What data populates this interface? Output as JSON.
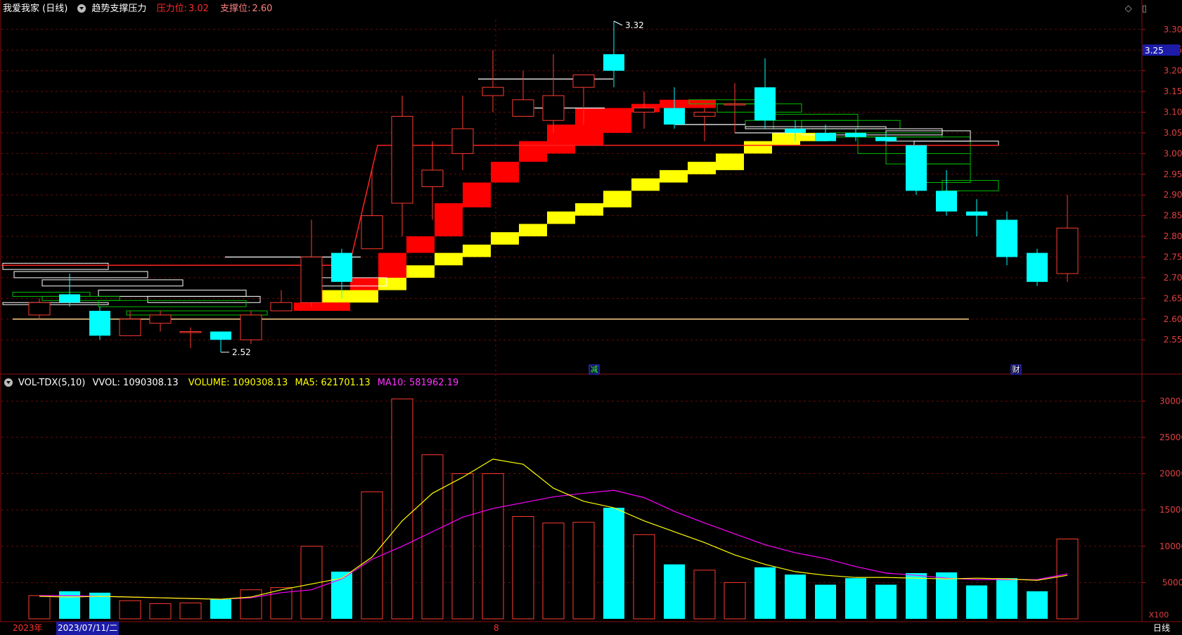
{
  "header": {
    "title": "我爱我家 (日线)",
    "indicator": "趋势支撑压力",
    "pressure_label": "压力位:",
    "pressure_value": "3.02",
    "support_label": "支撑位:",
    "support_value": "2.60"
  },
  "vol_header": {
    "name": "VOL-TDX(5,10)",
    "vvol": "VVOL: 1090308.13",
    "volume": "VOLUME: 1090308.13",
    "ma5": "MA5: 621701.13",
    "ma10": "MA10: 581962.19"
  },
  "colors": {
    "up": "#ff3b30",
    "down": "#00ffff",
    "ma5": "#ffff00",
    "ma10": "#ff00ff",
    "red_band": "#ff0000",
    "yellow_band": "#ffff00",
    "support": "#ffd28a",
    "pressure": "#ff2020"
  },
  "chart_data": [
    {
      "type": "candlestick",
      "ylim": [
        2.51,
        3.34
      ],
      "yticks": [
        2.55,
        2.6,
        2.65,
        2.7,
        2.75,
        2.8,
        2.85,
        2.9,
        2.95,
        3.0,
        3.05,
        3.1,
        3.15,
        3.2,
        3.25,
        3.3
      ],
      "current_price": "3.25",
      "high_annotation": "3.32",
      "low_annotation": "2.52",
      "support_level": 2.6,
      "pressure_level": 3.02,
      "event_markers": [
        "减",
        "财"
      ],
      "candles": [
        {
          "o": 2.61,
          "c": 2.64,
          "h": 2.65,
          "l": 2.6
        },
        {
          "o": 2.66,
          "c": 2.64,
          "h": 2.71,
          "l": 2.63
        },
        {
          "o": 2.62,
          "c": 2.56,
          "h": 2.63,
          "l": 2.55
        },
        {
          "o": 2.56,
          "c": 2.6,
          "h": 2.62,
          "l": 2.56
        },
        {
          "o": 2.59,
          "c": 2.61,
          "h": 2.62,
          "l": 2.57
        },
        {
          "o": 2.57,
          "c": 2.57,
          "h": 2.58,
          "l": 2.53
        },
        {
          "o": 2.57,
          "c": 2.55,
          "h": 2.57,
          "l": 2.52
        },
        {
          "o": 2.55,
          "c": 2.61,
          "h": 2.62,
          "l": 2.54
        },
        {
          "o": 2.62,
          "c": 2.64,
          "h": 2.67,
          "l": 2.62
        },
        {
          "o": 2.64,
          "c": 2.75,
          "h": 2.84,
          "l": 2.63
        },
        {
          "o": 2.76,
          "c": 2.69,
          "h": 2.77,
          "l": 2.65
        },
        {
          "o": 2.77,
          "c": 2.85,
          "h": 2.96,
          "l": 2.77
        },
        {
          "o": 2.88,
          "c": 3.09,
          "h": 3.14,
          "l": 2.8
        },
        {
          "o": 2.92,
          "c": 2.96,
          "h": 3.03,
          "l": 2.84
        },
        {
          "o": 3.0,
          "c": 3.06,
          "h": 3.14,
          "l": 2.96
        },
        {
          "o": 3.14,
          "c": 3.16,
          "h": 3.25,
          "l": 3.1
        },
        {
          "o": 3.09,
          "c": 3.13,
          "h": 3.2,
          "l": 3.09
        },
        {
          "o": 3.08,
          "c": 3.14,
          "h": 3.24,
          "l": 3.05
        },
        {
          "o": 3.16,
          "c": 3.19,
          "h": 3.19,
          "l": 3.07
        },
        {
          "o": 3.24,
          "c": 3.2,
          "h": 3.32,
          "l": 3.16
        },
        {
          "o": 3.1,
          "c": 3.11,
          "h": 3.15,
          "l": 3.06
        },
        {
          "o": 3.11,
          "c": 3.07,
          "h": 3.16,
          "l": 3.06
        },
        {
          "o": 3.09,
          "c": 3.1,
          "h": 3.11,
          "l": 3.03
        },
        {
          "o": 3.12,
          "c": 3.12,
          "h": 3.17,
          "l": 3.05
        },
        {
          "o": 3.16,
          "c": 3.08,
          "h": 3.23,
          "l": 3.06
        },
        {
          "o": 3.06,
          "c": 3.05,
          "h": 3.08,
          "l": 3.03
        },
        {
          "o": 3.05,
          "c": 3.03,
          "h": 3.07,
          "l": 3.03
        },
        {
          "o": 3.05,
          "c": 3.04,
          "h": 3.06,
          "l": 3.03
        },
        {
          "o": 3.04,
          "c": 3.03,
          "h": 3.05,
          "l": 3.02
        },
        {
          "o": 3.02,
          "c": 2.91,
          "h": 3.02,
          "l": 2.9
        },
        {
          "o": 2.91,
          "c": 2.86,
          "h": 2.96,
          "l": 2.85
        },
        {
          "o": 2.86,
          "c": 2.85,
          "h": 2.89,
          "l": 2.8
        },
        {
          "o": 2.84,
          "c": 2.75,
          "h": 2.86,
          "l": 2.73
        },
        {
          "o": 2.76,
          "c": 2.69,
          "h": 2.77,
          "l": 2.68
        },
        {
          "o": 2.71,
          "c": 2.82,
          "h": 2.9,
          "l": 2.69
        }
      ]
    },
    {
      "type": "bar",
      "series_name": "VOLUME",
      "unit": "X100",
      "ylim": [
        0,
        31000
      ],
      "yticks": [
        5000,
        10000,
        15000,
        20000,
        25000,
        30000
      ],
      "values": [
        3200,
        3800,
        3600,
        2500,
        2100,
        2200,
        2700,
        4000,
        4300,
        10000,
        6500,
        17500,
        30300,
        22600,
        20000,
        20000,
        14100,
        13200,
        13300,
        15300,
        11600,
        7500,
        6700,
        5000,
        7100,
        6100,
        4700,
        5600,
        4700,
        6300,
        6400,
        4600,
        5600,
        3800,
        11000
      ],
      "ma5": [
        3100,
        3000,
        3100,
        3000,
        2900,
        2800,
        2700,
        3000,
        4000,
        4800,
        5600,
        8500,
        13500,
        17300,
        19500,
        22000,
        21300,
        18000,
        16200,
        15300,
        13500,
        12000,
        10500,
        8800,
        7500,
        6500,
        6000,
        5700,
        5700,
        5600,
        5500,
        5600,
        5500,
        5300,
        6000
      ],
      "ma10": [
        3200,
        3200,
        3100,
        3000,
        2900,
        2800,
        2700,
        2900,
        3600,
        4000,
        5500,
        8200,
        10000,
        12000,
        14000,
        15200,
        16000,
        16800,
        17300,
        17700,
        16700,
        14800,
        13200,
        11700,
        10200,
        9100,
        8300,
        7200,
        6300,
        6000,
        5600,
        5400,
        5400,
        5400,
        6200
      ]
    }
  ],
  "axis_bottom": {
    "year_label": "2023年",
    "date_label": "2023/07/11/二",
    "month_mark": "8",
    "period": "日线"
  }
}
